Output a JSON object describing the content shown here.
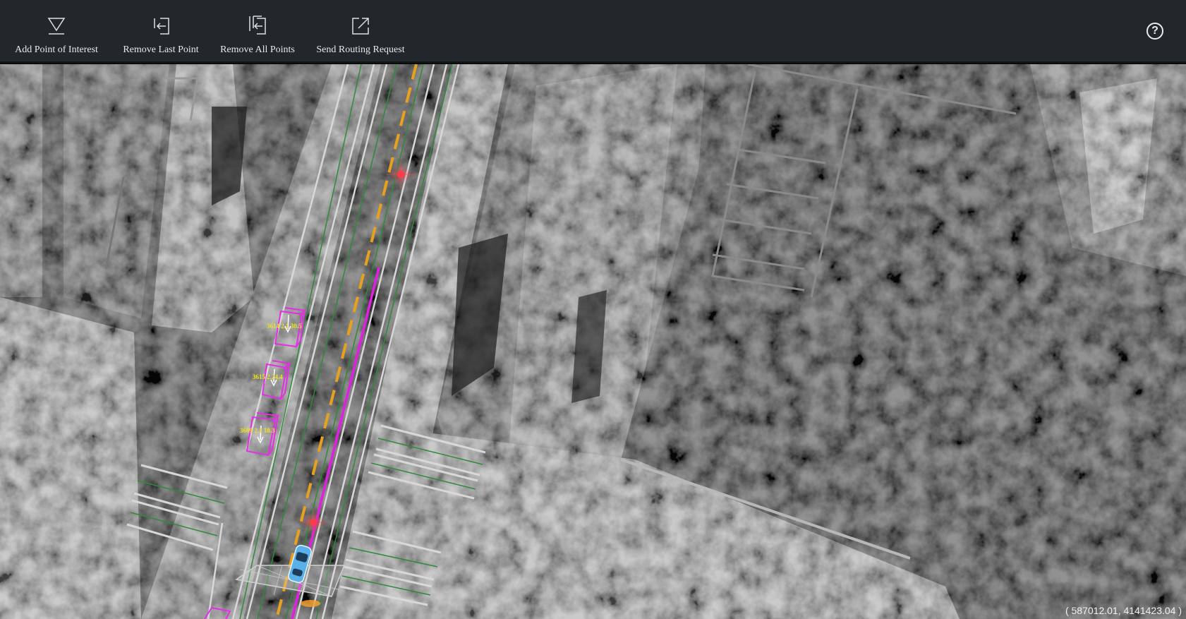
{
  "toolbar": {
    "buttons": [
      {
        "label": "Add Point of Interest",
        "icon": "add-point-icon"
      },
      {
        "label": "Remove Last Point",
        "icon": "remove-last-point-icon"
      },
      {
        "label": "Remove All Points",
        "icon": "remove-all-points-icon"
      },
      {
        "label": "Send Routing Request",
        "icon": "send-routing-request-icon"
      }
    ],
    "help_glyph": "?",
    "help_icon": "help-icon"
  },
  "map": {
    "coordinates": "( 587012.01, 4141423.04 )",
    "obstacles": [
      {
        "label": "3614 2.1 30.5"
      },
      {
        "label": "3615 2.24.4"
      },
      {
        "label": "3609 2.1 18.3"
      }
    ],
    "colors": {
      "obstacle": "#e62ee6",
      "obstacle_label": "#f2e21a",
      "route": "#e020e0",
      "lane_center_divider": "#e6a21c",
      "lane_center_line": "#2f8a3a",
      "lane_boundary": "#d8d8d8",
      "waypoint_marker": "#ff3b4a",
      "ego_vehicle": "#5ab0e8"
    }
  }
}
